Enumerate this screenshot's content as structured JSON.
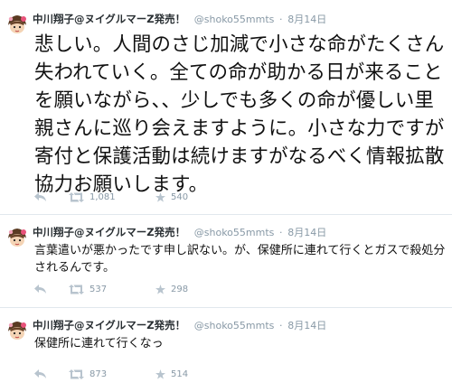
{
  "tweets": [
    {
      "name": "中川翔子@ヌイグルマーZ発売！",
      "handle": "@shoko55mmts",
      "separator": "·",
      "time": "8月14日",
      "text": "悲しい。人間のさじ加減で小さな命がたくさん失われていく。全ての命が助かる日が来ることを願いながら、、少しでも多くの命が優しい里親さんに巡り会えますように。小さな力ですが寄付と保護活動は続けますがなるべく情報拡散協力お願いします。",
      "retweets": "1,081",
      "favorites": "540"
    },
    {
      "name": "中川翔子@ヌイグルマーZ発売！",
      "handle": "@shoko55mmts",
      "separator": "·",
      "time": "8月14日",
      "text": "言葉遣いが悪かったです申し訳ない。が、保健所に連れて行くとガスで殺処分されるんです。",
      "retweets": "537",
      "favorites": "298"
    },
    {
      "name": "中川翔子@ヌイグルマーZ発売！",
      "handle": "@shoko55mmts",
      "separator": "·",
      "time": "8月14日",
      "text": "保健所に連れて行くなっ",
      "retweets": "873",
      "favorites": "514"
    }
  ],
  "icons": {
    "avatar": "avatar-illustration",
    "reply": "reply-icon",
    "retweet": "retweet-icon",
    "favorite": "favorite-star-icon"
  },
  "colors": {
    "text": "#292f33",
    "meta": "#8899a6",
    "divider": "#e1e8ed"
  }
}
